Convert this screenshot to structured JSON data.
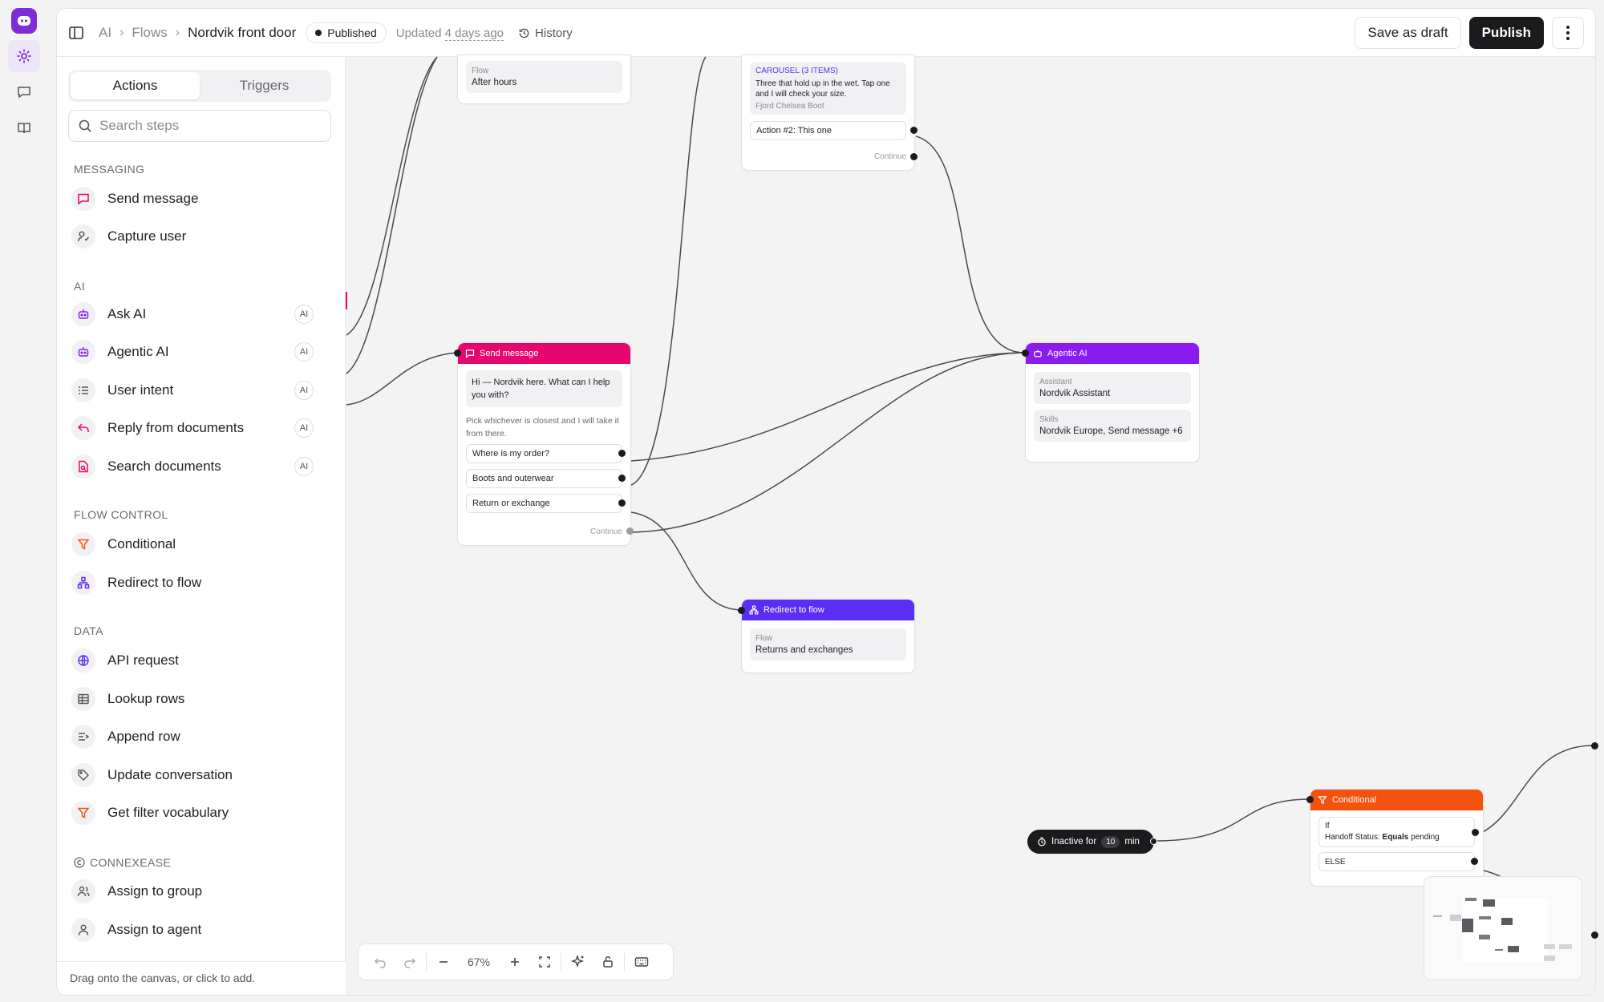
{
  "rail": {
    "logo": "bot-logo-icon",
    "items": [
      {
        "name": "flows-gear-icon",
        "active": true
      },
      {
        "name": "chat-icon",
        "active": false
      },
      {
        "name": "book-icon",
        "active": false
      }
    ]
  },
  "topbar": {
    "crumbs": [
      "AI",
      "Flows"
    ],
    "current": "Nordvik front door",
    "status": "Published",
    "updated_prefix": "Updated",
    "updated_when": "4 days ago",
    "history": "History",
    "save_draft": "Save as draft",
    "publish": "Publish"
  },
  "panel": {
    "tabs": [
      "Actions",
      "Triggers"
    ],
    "search_placeholder": "Search steps",
    "sections": {
      "messaging": "MESSAGING",
      "ai": "AI",
      "flow_control": "FLOW CONTROL",
      "data": "DATA",
      "connexease": "CONNEXEASE"
    },
    "messaging": [
      "Send message",
      "Capture user"
    ],
    "ai": [
      "Ask AI",
      "Agentic AI",
      "User intent",
      "Reply from documents",
      "Search documents"
    ],
    "ai_badge": "AI",
    "flow_control": [
      "Conditional",
      "Redirect to flow"
    ],
    "data": [
      "API request",
      "Lookup rows",
      "Append row",
      "Update conversation",
      "Get filter vocabulary"
    ],
    "connexease": [
      "Assign to group",
      "Assign to agent"
    ],
    "footer": "Drag onto the canvas, or click to add."
  },
  "canvas": {
    "after_hours": {
      "k": "Flow",
      "v": "After hours"
    },
    "carousel": {
      "title": "CAROUSEL (3 ITEMS)",
      "text": "Three that hold up in the wet. Tap one and I will check your size.",
      "sub": "Fjord Chelsea Boot",
      "action": "Action #2: This one",
      "continue": "Continue"
    },
    "send_message": {
      "header": "Send message",
      "bubble": "Hi — Nordvik here. What can I help you with?",
      "prompt": "Pick whichever is closest and I will take it from there.",
      "options": [
        "Where is my order?",
        "Boots and outerwear",
        "Return or exchange"
      ],
      "continue": "Continue"
    },
    "agentic": {
      "header": "Agentic AI",
      "assistant_k": "Assistant",
      "assistant_v": "Nordvik Assistant",
      "skills_k": "Skills",
      "skills_v": "Nordvik Europe, Send message +6"
    },
    "redirect": {
      "header": "Redirect to flow",
      "k": "Flow",
      "v": "Returns and exchanges"
    },
    "conditional": {
      "header": "Conditional",
      "if": "If",
      "field": "Handoff Status:",
      "op": "Equals",
      "val": "pending",
      "else": "ELSE"
    },
    "inactive": {
      "prefix": "Inactive for",
      "num": "10",
      "unit": "min"
    },
    "colors": {
      "send": "#e6076e",
      "agentic": "#8b1cf0",
      "redirect": "#5b2ef5",
      "conditional": "#f5520e"
    }
  },
  "toolbar": {
    "zoom": "67%"
  }
}
